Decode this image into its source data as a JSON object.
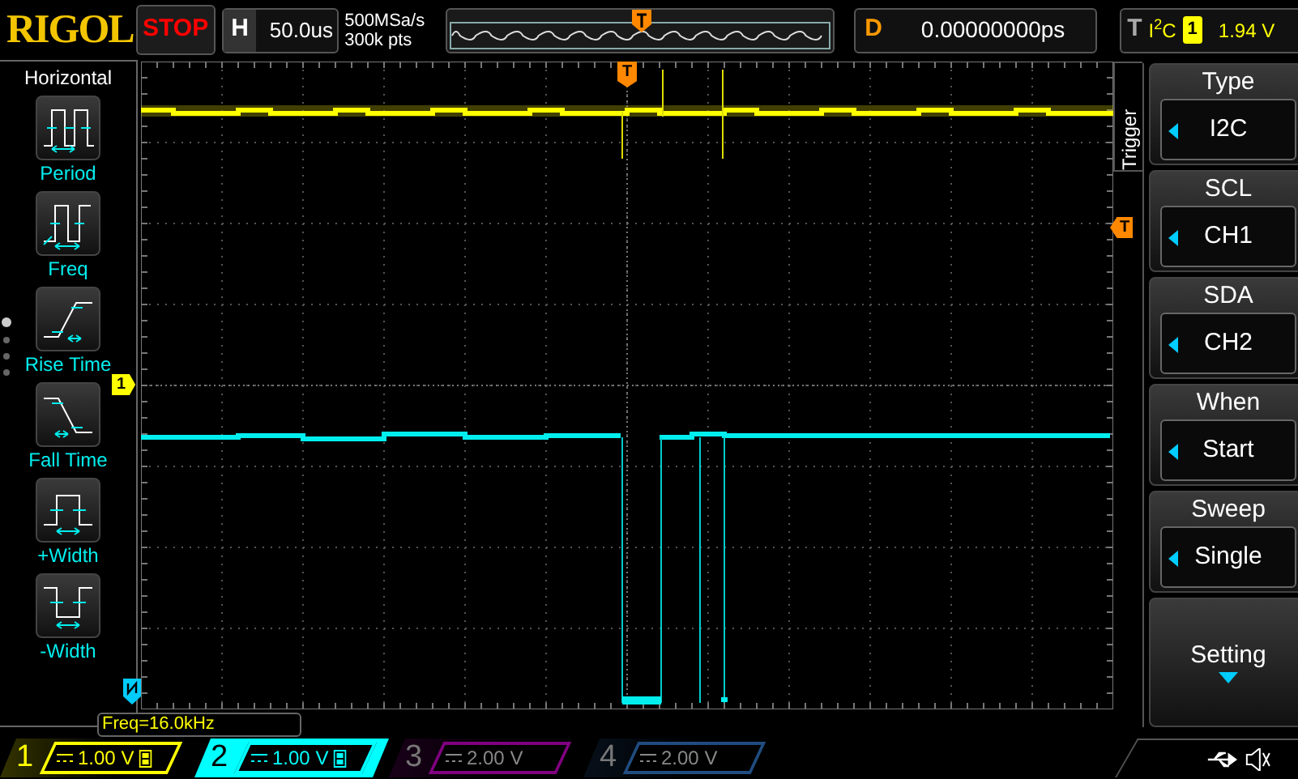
{
  "brand": "RIGOL",
  "run_state": "STOP",
  "horizontal": {
    "label": "H",
    "timebase": "50.0us"
  },
  "acquisition": {
    "sample_rate": "500MSa/s",
    "memory_depth": "300k pts"
  },
  "delay": {
    "label": "D",
    "value": "0.00000000ps"
  },
  "trigger": {
    "label": "T",
    "type": "I$^{2}$C",
    "source": "1",
    "level": "1.94 V"
  },
  "measure_menu": {
    "title": "Horizontal",
    "items": [
      {
        "kind": "period",
        "label": "Period"
      },
      {
        "kind": "freq",
        "label": "Freq"
      },
      {
        "kind": "rise",
        "label": "Rise Time"
      },
      {
        "kind": "fall",
        "label": "Fall Time"
      },
      {
        "kind": "pwidth",
        "label": "+Width"
      },
      {
        "kind": "nwidth",
        "label": "-Width"
      }
    ],
    "pages": [
      {
        "selected": true
      },
      {
        "selected": false
      },
      {
        "selected": false
      },
      {
        "selected": false
      }
    ]
  },
  "markers": {
    "channel_1": "1",
    "trigger_top": "T",
    "trigger_level": "T"
  },
  "measurement": "Freq=16.0kHz",
  "side_menu": {
    "title": "Trigger",
    "items": [
      {
        "kind": "option",
        "title": "Type",
        "value": "I2C"
      },
      {
        "kind": "option",
        "title": "SCL",
        "value": "CH1"
      },
      {
        "kind": "option",
        "title": "SDA",
        "value": "CH2"
      },
      {
        "kind": "option",
        "title": "When",
        "value": "Start"
      },
      {
        "kind": "option",
        "title": "Sweep",
        "value": "Single"
      },
      {
        "kind": "submenu",
        "title": "Setting"
      }
    ]
  },
  "channels": [
    {
      "number": "1",
      "scale": "1.00 V",
      "enabled": true,
      "selected": false,
      "color": "#ffff00"
    },
    {
      "number": "2",
      "scale": "1.00 V",
      "enabled": true,
      "selected": true,
      "color": "#00ffff"
    },
    {
      "number": "3",
      "scale": "2.00 V",
      "enabled": false,
      "selected": false,
      "color": "#800080"
    },
    {
      "number": "4",
      "scale": "2.00 V",
      "enabled": false,
      "selected": false,
      "color": "#204c80"
    }
  ]
}
